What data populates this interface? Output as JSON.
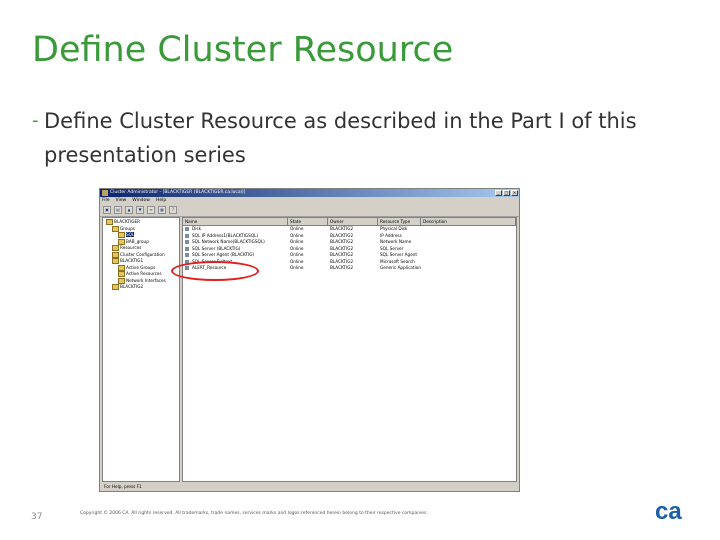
{
  "slide": {
    "title": "Define Cluster Resource",
    "bullet_dash": "-",
    "bullet": "Define Cluster Resource as described in the Part I of this presentation series",
    "page_number": "37",
    "copyright": "Copyright © 2006 CA. All rights reserved. All trademarks, trade names, services marks and logos referenced herein belong to their respective companies.",
    "logo_text": "ca",
    "colors": {
      "title_green": "#3a9a3a",
      "logo_blue": "#1b5fa6",
      "highlight_red": "#e02020"
    }
  },
  "window": {
    "title": "Cluster Administrator - [BLACKTIGER (BLACKTIGER.ca.local)]",
    "buttons": [
      "_",
      "□",
      "×"
    ],
    "menu": [
      "File",
      "View",
      "Window",
      "Help"
    ],
    "toolbar_icons": [
      "open-icon",
      "properties-icon",
      "bring-online-icon",
      "take-offline-icon",
      "list-icon",
      "details-icon",
      "help-icon"
    ],
    "tree": [
      {
        "label": "BLACKTIGER",
        "indent": 0
      },
      {
        "label": "Groups",
        "indent": 1
      },
      {
        "label": "SQL",
        "indent": 2,
        "selected": true
      },
      {
        "label": "BAB_group",
        "indent": 2
      },
      {
        "label": "Resources",
        "indent": 1
      },
      {
        "label": "Cluster Configuration",
        "indent": 1
      },
      {
        "label": "BLACKTIG1",
        "indent": 1
      },
      {
        "label": "Active Groups",
        "indent": 2
      },
      {
        "label": "Active Resources",
        "indent": 2
      },
      {
        "label": "Network Interfaces",
        "indent": 2
      },
      {
        "label": "BLACKTIG2",
        "indent": 1
      }
    ],
    "columns": [
      "Name",
      "State",
      "Owner",
      "Resource Type",
      "Description"
    ],
    "rows": [
      [
        "Disk",
        "Online",
        "BLACKTIG2",
        "Physical Disk",
        ""
      ],
      [
        "SQL IP Address1(BLACKTIGSQL)",
        "Online",
        "BLACKTIG2",
        "IP Address",
        ""
      ],
      [
        "SQL Network Name(BLACKTIGSQL)",
        "Online",
        "BLACKTIG2",
        "Network Name",
        ""
      ],
      [
        "SQL Server (BLACKTIG)",
        "Online",
        "BLACKTIG2",
        "SQL Server",
        ""
      ],
      [
        "SQL Server Agent (BLACKTIG)",
        "Online",
        "BLACKTIG2",
        "SQL Server Agent",
        ""
      ],
      [
        "SQL Server Fulltext",
        "Online",
        "BLACKTIG2",
        "Microsoft Search",
        ""
      ],
      [
        "ALERT_Resource",
        "Online",
        "BLACKTIG2",
        "Generic Application",
        ""
      ]
    ],
    "status": "For Help, press F1"
  }
}
